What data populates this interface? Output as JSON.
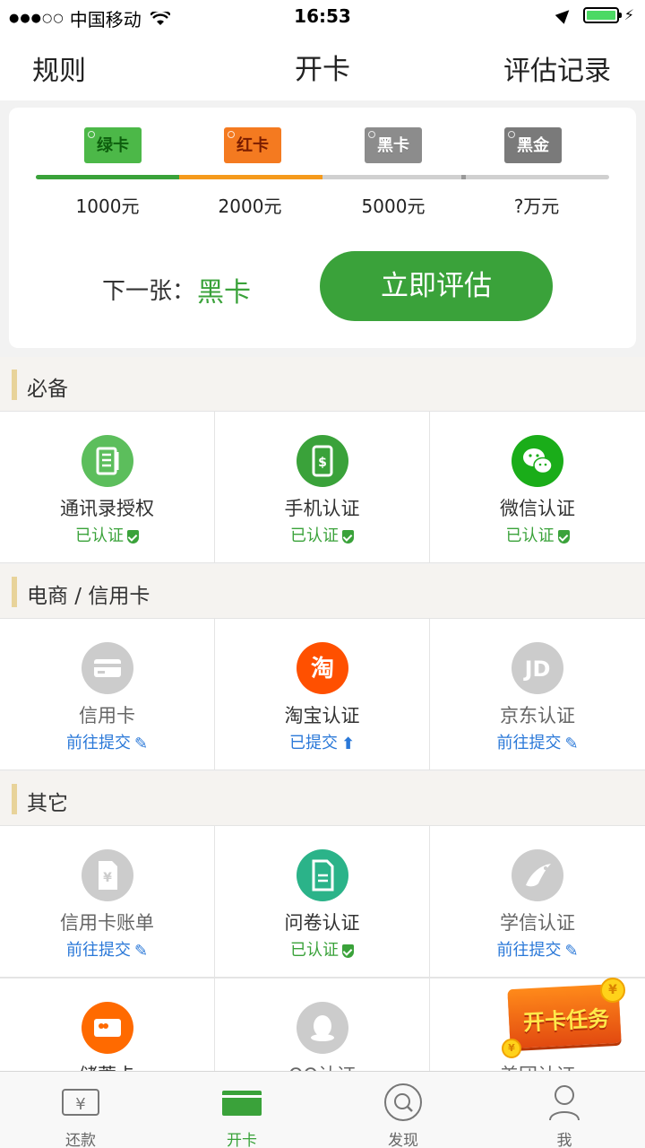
{
  "status_bar": {
    "carrier": "中国移动",
    "time": "16:53"
  },
  "nav": {
    "left": "规则",
    "title": "开卡",
    "right": "评估记录"
  },
  "tiers": [
    {
      "label": "绿卡",
      "amount": "1000元",
      "color": "#4cb848"
    },
    {
      "label": "红卡",
      "amount": "2000元",
      "color": "#f47a20"
    },
    {
      "label": "黑卡",
      "amount": "5000元",
      "color": "#8c8c8c"
    },
    {
      "label": "黑金",
      "amount": "?万元",
      "color": "#7a7a7a"
    }
  ],
  "next_card": {
    "label": "下一张：",
    "value": "黑卡"
  },
  "evaluate_button": "立即评估",
  "sections": [
    {
      "title": "必备",
      "items": [
        {
          "name": "通讯录授权",
          "status": "已认证",
          "kind": "ok",
          "icon": "contacts-icon",
          "color": "#5cbe5c"
        },
        {
          "name": "手机认证",
          "status": "已认证",
          "kind": "ok",
          "icon": "phone-icon",
          "color": "#3aa23a"
        },
        {
          "name": "微信认证",
          "status": "已认证",
          "kind": "ok",
          "icon": "wechat-icon",
          "color": "#1aad19"
        }
      ]
    },
    {
      "title": "电商 / 信用卡",
      "items": [
        {
          "name": "信用卡",
          "status": "前往提交",
          "kind": "go",
          "icon": "credit-card-icon",
          "color": "#cccccc"
        },
        {
          "name": "淘宝认证",
          "status": "已提交",
          "kind": "up",
          "icon": "taobao-icon",
          "color": "#ff5000"
        },
        {
          "name": "京东认证",
          "status": "前往提交",
          "kind": "go",
          "icon": "jd-icon",
          "color": "#cccccc"
        }
      ]
    },
    {
      "title": "其它",
      "items": [
        {
          "name": "信用卡账单",
          "status": "前往提交",
          "kind": "go",
          "icon": "bill-icon",
          "color": "#cccccc"
        },
        {
          "name": "问卷认证",
          "status": "已认证",
          "kind": "ok",
          "icon": "survey-icon",
          "color": "#2bb389"
        },
        {
          "name": "学信认证",
          "status": "前往提交",
          "kind": "go",
          "icon": "education-icon",
          "color": "#cccccc"
        }
      ]
    }
  ],
  "extra_row": [
    {
      "name": "储蓄卡",
      "icon": "debit-card-icon",
      "color": "#ff6a00"
    },
    {
      "name": "QQ认证",
      "icon": "qq-icon",
      "color": "#cccccc"
    },
    {
      "name": "美团认证",
      "icon": "meituan-icon",
      "color": "#cccccc"
    }
  ],
  "promo": {
    "text": "开卡任务",
    "coin": "¥"
  },
  "tabs": [
    {
      "label": "还款",
      "icon": "repay-icon"
    },
    {
      "label": "开卡",
      "icon": "card-icon",
      "active": true
    },
    {
      "label": "发现",
      "icon": "discover-icon"
    },
    {
      "label": "我",
      "icon": "profile-icon"
    }
  ]
}
